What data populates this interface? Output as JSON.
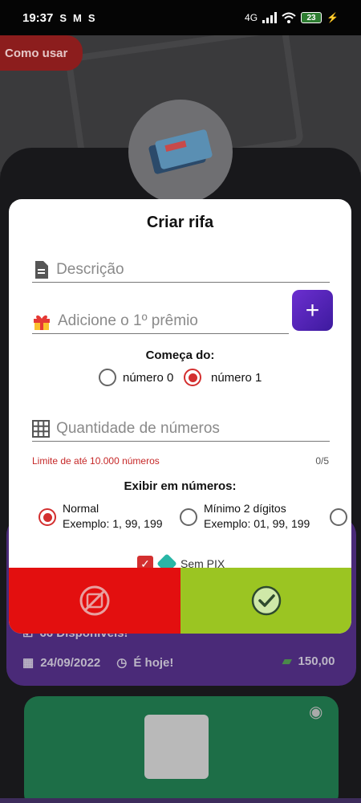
{
  "status_bar": {
    "time": "19:37",
    "indicators": [
      "S",
      "M",
      "S"
    ],
    "network": "4G",
    "battery": "23"
  },
  "background": {
    "howto_label": "Como usar",
    "available_text": "66 Disponíveis!",
    "date": "24/09/2022",
    "today_text": "É hoje!",
    "price": "150,00"
  },
  "modal": {
    "title": "Criar rifa",
    "description_placeholder": "Descrição",
    "prize_placeholder": "Adicione o 1º prêmio",
    "add_prize_label": "+",
    "starts_from_label": "Começa do:",
    "start_options": [
      {
        "label": "número 0",
        "checked": false
      },
      {
        "label": "número 1",
        "checked": true
      }
    ],
    "quantity_placeholder": "Quantidade de números",
    "limit_hint": "Limite de até 10.000 números",
    "char_counter": "0/5",
    "display_label": "Exibir em números:",
    "display_options": [
      {
        "title": "Normal",
        "example": "Exemplo: 1, 99, 199",
        "checked": true
      },
      {
        "title": "Mínimo 2 dígitos",
        "example": "Exemplo: 01, 99, 199",
        "checked": false
      }
    ],
    "no_pix_label": "Sem PIX",
    "accent": "#d32f2f",
    "cancel_color": "#e30f0f",
    "confirm_color": "#9bc522"
  }
}
